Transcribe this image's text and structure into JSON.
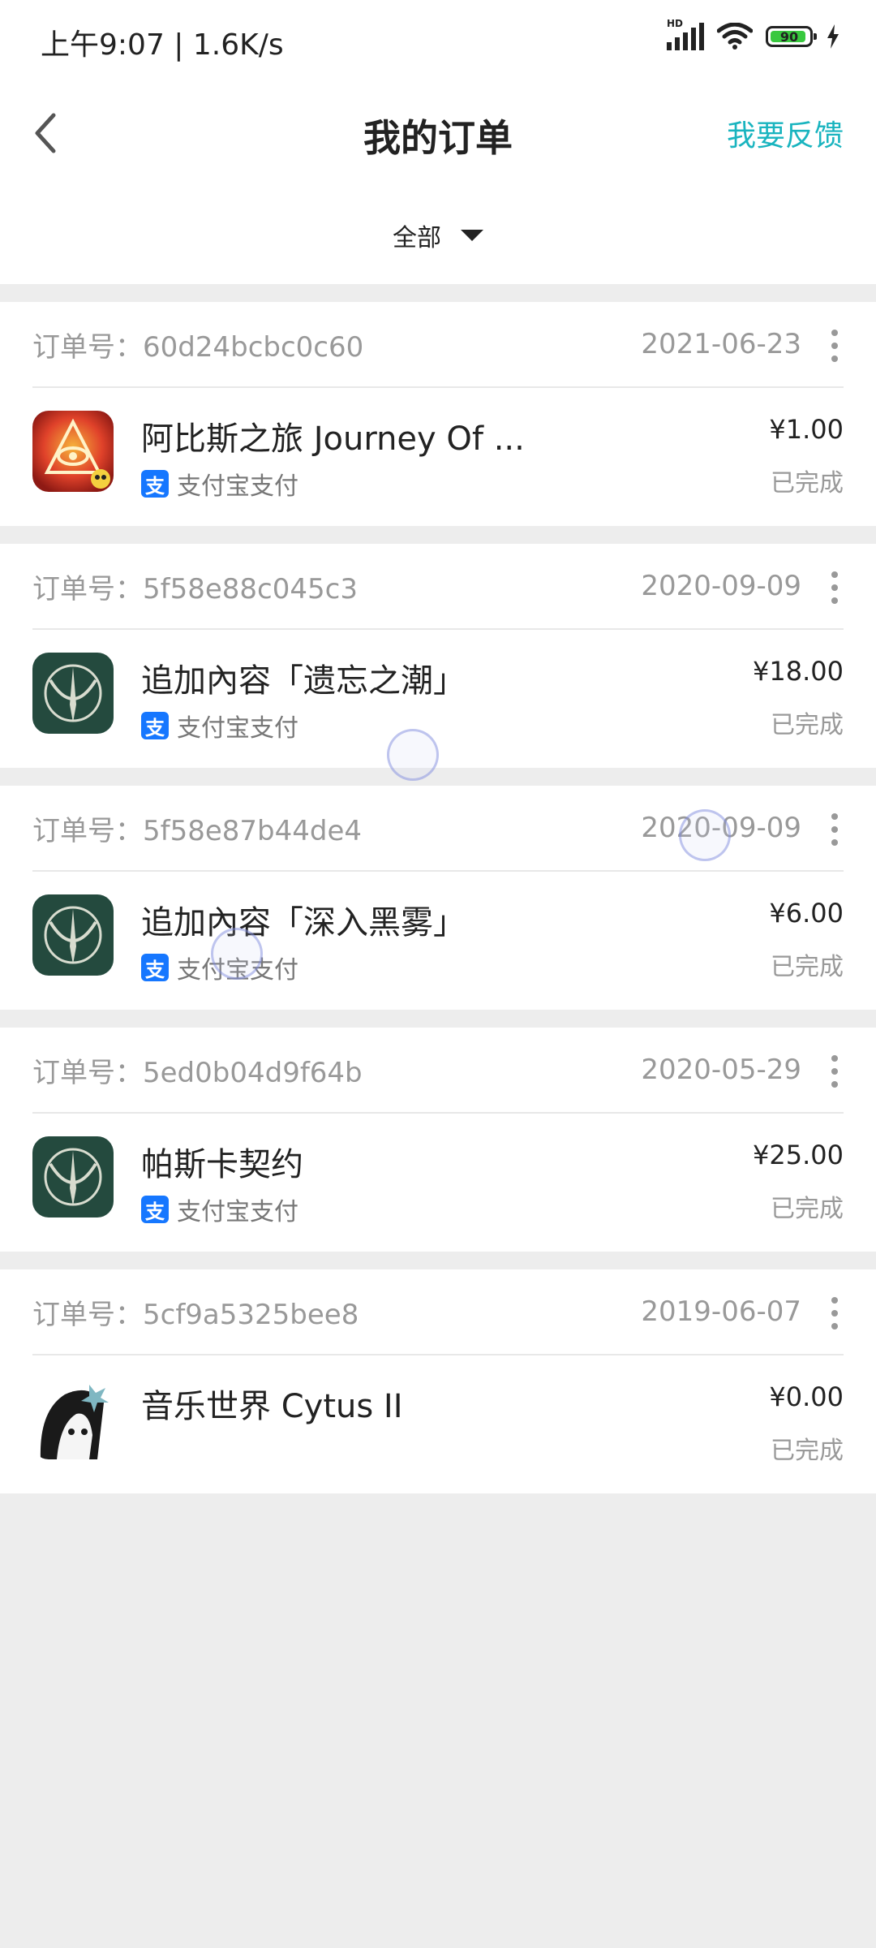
{
  "status_bar": {
    "time": "上午9:07 | 1.6K/s",
    "battery": "90",
    "signal_badge": "HD"
  },
  "header": {
    "title": "我的订单",
    "feedback_label": "我要反馈"
  },
  "filter": {
    "selected": "全部"
  },
  "orders": [
    {
      "order_no": "订单号：60d24bcbc0c60",
      "date": "2021-06-23",
      "name": "阿比斯之旅 Journey Of ...",
      "payment": "支付宝支付",
      "price": "¥1.00",
      "status": "已完成",
      "icon": "journey-of-abyss-app-icon"
    },
    {
      "order_no": "订单号：5f58e88c045c3",
      "date": "2020-09-09",
      "name": "追加內容「遗忘之潮」",
      "payment": "支付宝支付",
      "price": "¥18.00",
      "status": "已完成",
      "icon": "pascal-contract-app-icon"
    },
    {
      "order_no": "订单号：5f58e87b44de4",
      "date": "2020-09-09",
      "name": "追加內容「深入黑雾」",
      "payment": "支付宝支付",
      "price": "¥6.00",
      "status": "已完成",
      "icon": "pascal-contract-app-icon"
    },
    {
      "order_no": "订单号：5ed0b04d9f64b",
      "date": "2020-05-29",
      "name": "帕斯卡契约",
      "payment": "支付宝支付",
      "price": "¥25.00",
      "status": "已完成",
      "icon": "pascal-contract-app-icon"
    },
    {
      "order_no": "订单号：5cf9a5325bee8",
      "date": "2019-06-07",
      "name": "音乐世界 Cytus II",
      "payment": "",
      "price": "¥0.00",
      "status": "已完成",
      "icon": "cytus-ii-app-icon"
    }
  ],
  "colors": {
    "accent": "#19b4bf",
    "alipay": "#1677ff",
    "background": "#ededed"
  },
  "alipay_icon_glyph": "支"
}
